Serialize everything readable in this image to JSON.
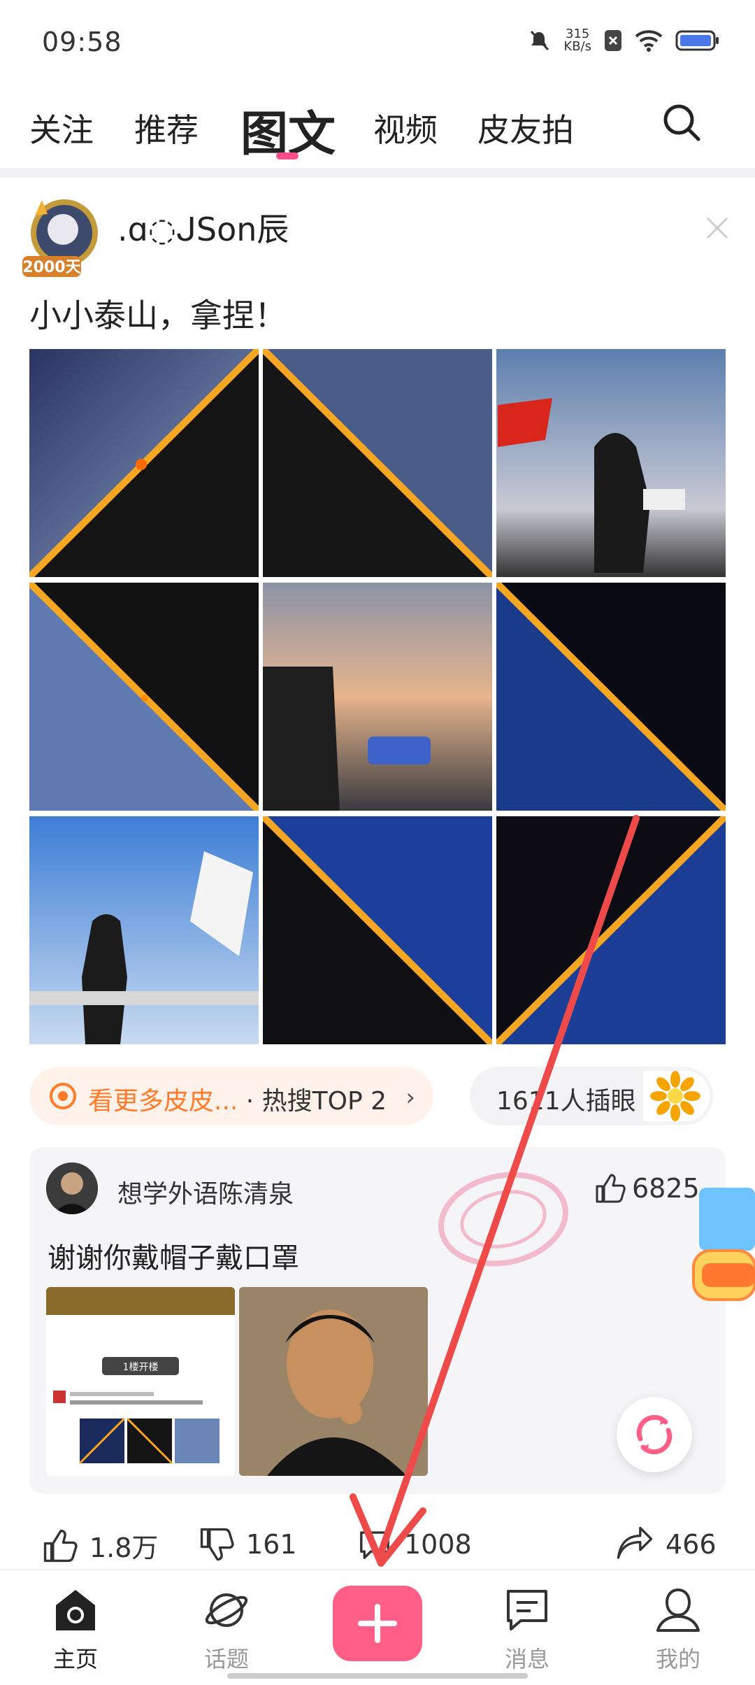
{
  "status_bar": {
    "time": "09:58",
    "speed_value": "315",
    "speed_unit": "KB/s",
    "icons": [
      "mute-icon",
      "speed-indicator",
      "sim-x-icon",
      "wifi-icon",
      "battery-icon"
    ]
  },
  "tabs": [
    {
      "label": "关注",
      "active": false
    },
    {
      "label": "推荐",
      "active": false
    },
    {
      "label": "图文",
      "active": true
    },
    {
      "label": "视频",
      "active": false
    },
    {
      "label": "皮友拍",
      "active": false
    }
  ],
  "accent_color": "#ff4d8a",
  "post": {
    "avatar_badge": "2000天",
    "username": ".ɑ◌ᒍSon辰",
    "text": "小小泰山，拿捏！",
    "images": [
      "sunrise-diagonal-1",
      "sunrise-diagonal-2",
      "person-with-red-flag",
      "sunrise-diagonal-3",
      "person-with-can",
      "sunrise-diagonal-4",
      "person-with-white-flag",
      "sunrise-diagonal-5",
      "sunrise-diagonal-6"
    ]
  },
  "hot_pill": {
    "label": "看更多皮皮...",
    "suffix": " · 热搜TOP 2",
    "chevron": "›"
  },
  "count_pill": {
    "label": "1611人插眼"
  },
  "top_comment": {
    "username": "想学外语陈清泉",
    "likes": "6825",
    "text": "谢谢你戴帽子戴口罩",
    "thumb1_caption": "1楼开楼"
  },
  "actions": {
    "likes": "1.8万",
    "dislikes": "161",
    "comments": "1008",
    "shares": "466"
  },
  "bottom_nav": [
    {
      "label": "主页",
      "active": true
    },
    {
      "label": "话题",
      "active": false
    },
    {
      "label": "",
      "active": false
    },
    {
      "label": "消息",
      "active": false
    },
    {
      "label": "我的",
      "active": false
    }
  ]
}
